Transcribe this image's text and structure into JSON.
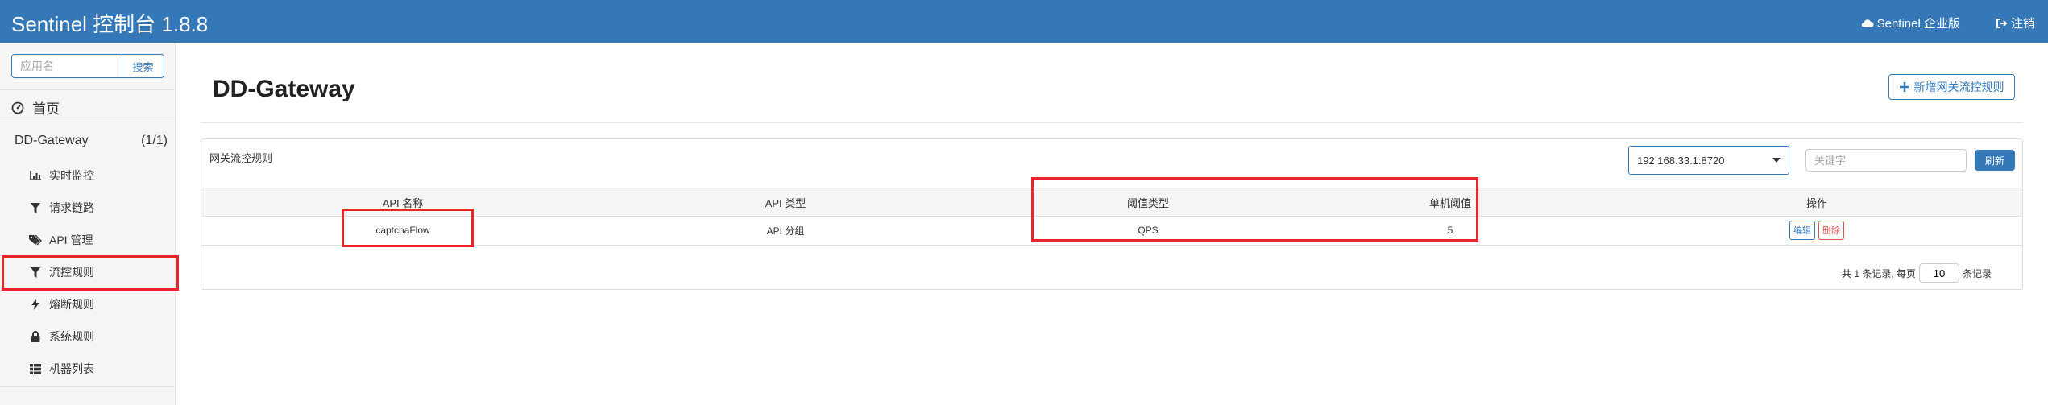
{
  "navbar": {
    "brand": "Sentinel 控制台 1.8.8",
    "enterprise_label": "Sentinel 企业版",
    "logout_label": "注销"
  },
  "sidebar": {
    "search_placeholder": "应用名",
    "search_button": "搜索",
    "home_label": "首页",
    "app_name": "DD-Gateway",
    "app_count": "(1/1)",
    "items": [
      {
        "label": "实时监控",
        "icon": "bar-chart-icon"
      },
      {
        "label": "请求链路",
        "icon": "filter-icon"
      },
      {
        "label": "API 管理",
        "icon": "tags-icon"
      },
      {
        "label": "流控规则",
        "icon": "filter-icon"
      },
      {
        "label": "熔断规则",
        "icon": "flash-icon"
      },
      {
        "label": "系统规则",
        "icon": "lock-icon"
      },
      {
        "label": "机器列表",
        "icon": "th-list-icon"
      }
    ]
  },
  "main": {
    "title": "DD-Gateway",
    "add_button": "新增网关流控规则",
    "panel": {
      "title": "网关流控规则",
      "machine": "192.168.33.1:8720",
      "keyword_placeholder": "关键字",
      "refresh_button": "刷新",
      "columns": [
        "API 名称",
        "API 类型",
        "阈值类型",
        "单机阈值",
        "操作"
      ],
      "rows": [
        {
          "api_name": "captchaFlow",
          "api_type": "API 分组",
          "threshold_type": "QPS",
          "threshold": "5",
          "edit": "编辑",
          "delete": "删除"
        }
      ],
      "pager": {
        "prefix": "共 1 条记录, 每页",
        "page_size": "10",
        "suffix": "条记录"
      }
    }
  },
  "colors": {
    "navbar": "#3478b8",
    "primary": "#3478b8",
    "highlight": "#e8262a",
    "danger": "#d9534f"
  }
}
